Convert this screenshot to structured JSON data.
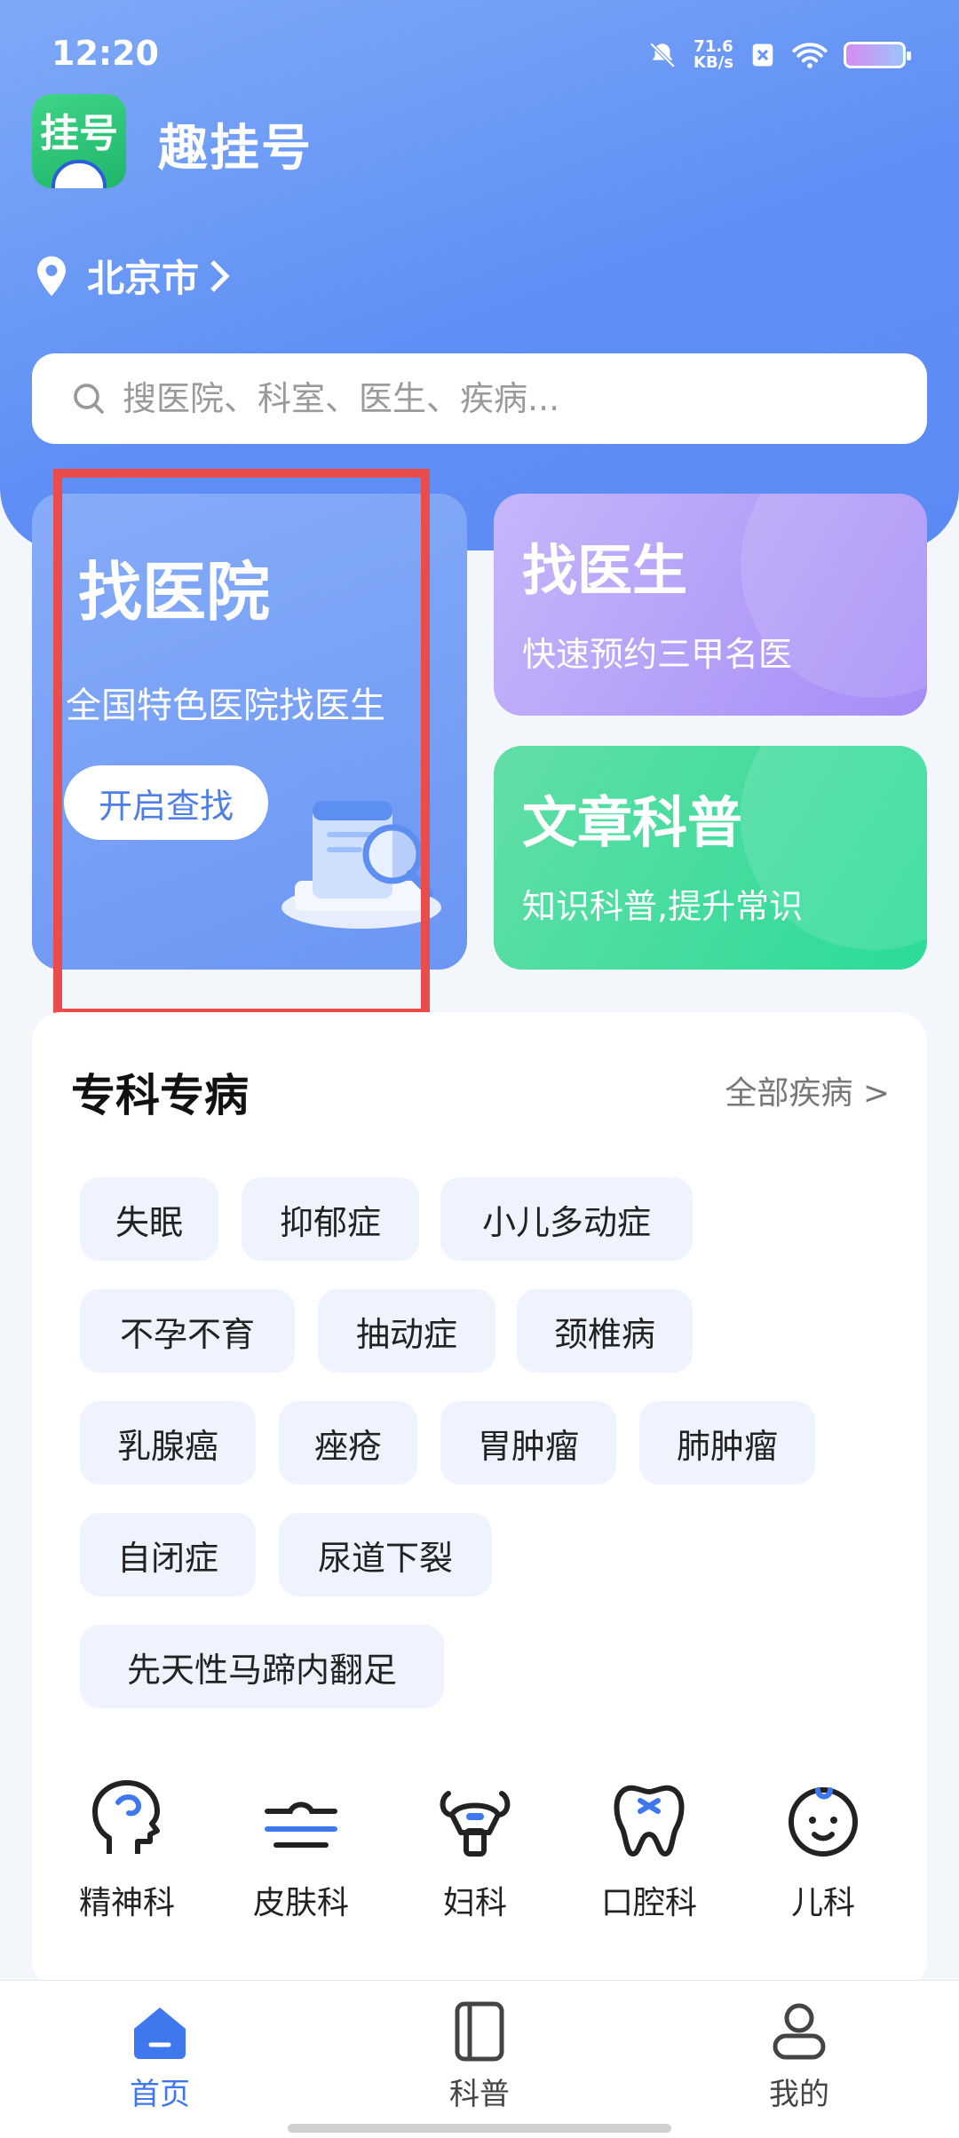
{
  "status": {
    "time": "12:20",
    "net_speed": "71.6",
    "net_unit": "KB/s"
  },
  "app": {
    "logo_text": "挂号",
    "name": "趣挂号"
  },
  "location": {
    "city": "北京市"
  },
  "search": {
    "placeholder": "搜医院、科室、医生、疾病..."
  },
  "cards": {
    "hospital": {
      "title": "找医院",
      "subtitle": "全国特色医院找医生",
      "button": "开启查找"
    },
    "doctor": {
      "title": "找医生",
      "subtitle": "快速预约三甲名医"
    },
    "article": {
      "title": "文章科普",
      "subtitle": "知识科普,提升常识"
    }
  },
  "specialty": {
    "title": "专科专病",
    "more": "全部疾病 >",
    "tags": [
      "失眠",
      "抑郁症",
      "小儿多动症",
      "不孕不育",
      "抽动症",
      "颈椎病",
      "乳腺癌",
      "痤疮",
      "胃肿瘤",
      "肺肿瘤",
      "自闭症",
      "尿道下裂",
      "先天性马蹄内翻足"
    ]
  },
  "departments": [
    {
      "label": "精神科",
      "icon": "brain-head-icon"
    },
    {
      "label": "皮肤科",
      "icon": "skin-icon"
    },
    {
      "label": "妇科",
      "icon": "uterus-icon"
    },
    {
      "label": "口腔科",
      "icon": "tooth-icon"
    },
    {
      "label": "儿科",
      "icon": "baby-face-icon"
    }
  ],
  "tabbar": [
    {
      "label": "首页",
      "icon": "home-icon",
      "active": true
    },
    {
      "label": "科普",
      "icon": "book-icon",
      "active": false
    },
    {
      "label": "我的",
      "icon": "user-icon",
      "active": false
    }
  ],
  "colors": {
    "accent": "#3f78ee",
    "header": "#6b96f3",
    "doctor_card": "#a58cf6",
    "article_card": "#2bdb97",
    "highlight": "#ea4b4b"
  }
}
